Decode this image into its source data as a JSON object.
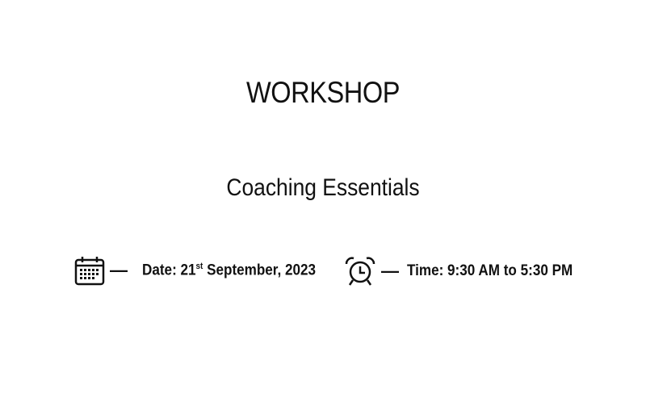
{
  "title": "WORKSHOP",
  "subtitle": "Coaching Essentials",
  "date": {
    "icon": "calendar-icon",
    "dash": "—",
    "prefix": "Date: 21",
    "suffix_sup": "st",
    "rest": " September, 2023"
  },
  "time": {
    "icon": "alarm-clock-icon",
    "dash": "—",
    "text": "Time: 9:30 AM to 5:30 PM"
  }
}
